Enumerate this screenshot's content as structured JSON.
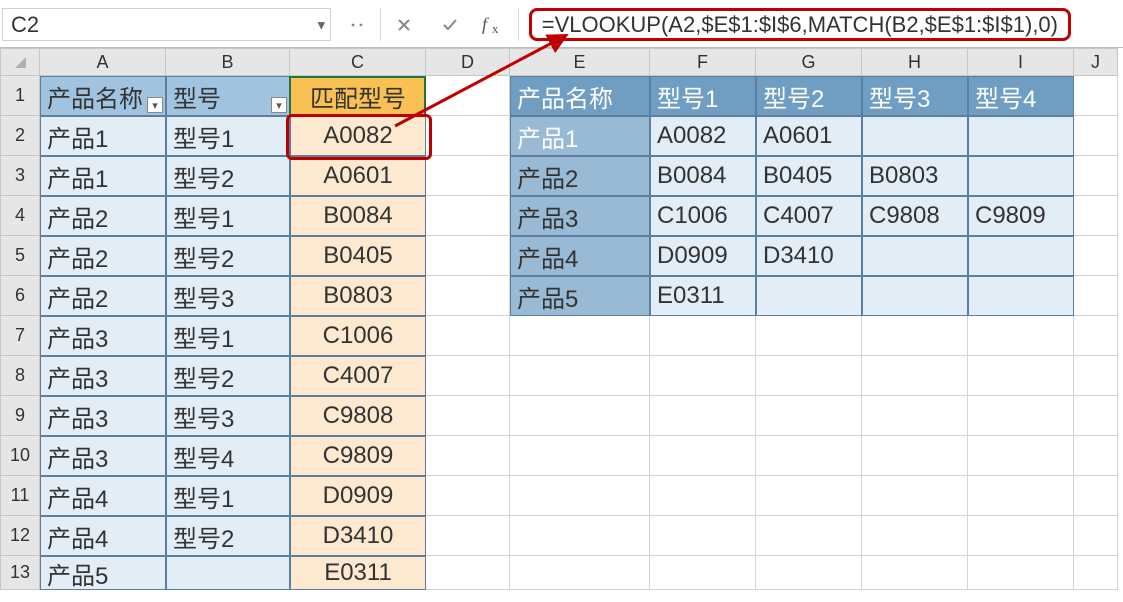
{
  "name_box": "C2",
  "formula": "=VLOOKUP(A2,$E$1:$I$6,MATCH(B2,$E$1:$I$1),0)",
  "columns": [
    "A",
    "B",
    "C",
    "D",
    "E",
    "F",
    "G",
    "H",
    "I",
    "J"
  ],
  "row_numbers": [
    "1",
    "2",
    "3",
    "4",
    "5",
    "6",
    "7",
    "8",
    "9",
    "10",
    "11",
    "12",
    "13"
  ],
  "left_table": {
    "headers": {
      "A": "产品名称",
      "B": "型号",
      "C": "匹配型号"
    },
    "rows": [
      {
        "A": "产品1",
        "B": "型号1",
        "C": "A0082"
      },
      {
        "A": "产品1",
        "B": "型号2",
        "C": "A0601"
      },
      {
        "A": "产品2",
        "B": "型号1",
        "C": "B0084"
      },
      {
        "A": "产品2",
        "B": "型号2",
        "C": "B0405"
      },
      {
        "A": "产品2",
        "B": "型号3",
        "C": "B0803"
      },
      {
        "A": "产品3",
        "B": "型号1",
        "C": "C1006"
      },
      {
        "A": "产品3",
        "B": "型号2",
        "C": "C4007"
      },
      {
        "A": "产品3",
        "B": "型号3",
        "C": "C9808"
      },
      {
        "A": "产品3",
        "B": "型号4",
        "C": "C9809"
      },
      {
        "A": "产品4",
        "B": "型号1",
        "C": "D0909"
      },
      {
        "A": "产品4",
        "B": "型号2",
        "C": "D3410"
      },
      {
        "A": "产品5",
        "B": "",
        "C": "E0311"
      }
    ]
  },
  "right_table": {
    "headers": {
      "E": "产品名称",
      "F": "型号1",
      "G": "型号2",
      "H": "型号3",
      "I": "型号4"
    },
    "rows": [
      {
        "E": "产品1",
        "F": "A0082",
        "G": "A0601",
        "H": "",
        "I": ""
      },
      {
        "E": "产品2",
        "F": "B0084",
        "G": "B0405",
        "H": "B0803",
        "I": ""
      },
      {
        "E": "产品3",
        "F": "C1006",
        "G": "C4007",
        "H": "C9808",
        "I": "C9809"
      },
      {
        "E": "产品4",
        "F": "D0909",
        "G": "D3410",
        "H": "",
        "I": ""
      },
      {
        "E": "产品5",
        "F": "E0311",
        "G": "",
        "H": "",
        "I": ""
      }
    ]
  }
}
